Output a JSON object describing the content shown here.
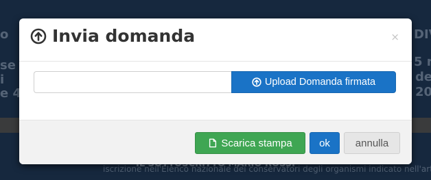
{
  "modal": {
    "title": "Invia domanda",
    "close_symbol": "×",
    "title_icon": "circle-arrow-up-icon",
    "file_input": {
      "value": "",
      "placeholder": ""
    },
    "upload_button": {
      "label": "Upload Domanda firmata",
      "icon": "circle-arrow-up-icon"
    },
    "footer": {
      "scarica_label": "Scarica stampa",
      "scarica_icon": "file-icon",
      "ok_label": "ok",
      "annulla_label": "annulla"
    }
  },
  "backdrop": {
    "left_fragments": [
      "o",
      "se",
      "i",
      "e 4"
    ],
    "right_fragments": [
      "DIV",
      "5 n",
      "de",
      "20"
    ],
    "bottom_line": "IL SOTTOSCRITTO MARIO ROSSI",
    "bottom_line2": "iscrizione nell'Elenco nazionale dei conservatori degli organismi indicato nell'art."
  },
  "colors": {
    "primary": "#1a73c6",
    "success": "#3fa653",
    "default": "#e6e6e6",
    "backdrop": "#16283e"
  }
}
